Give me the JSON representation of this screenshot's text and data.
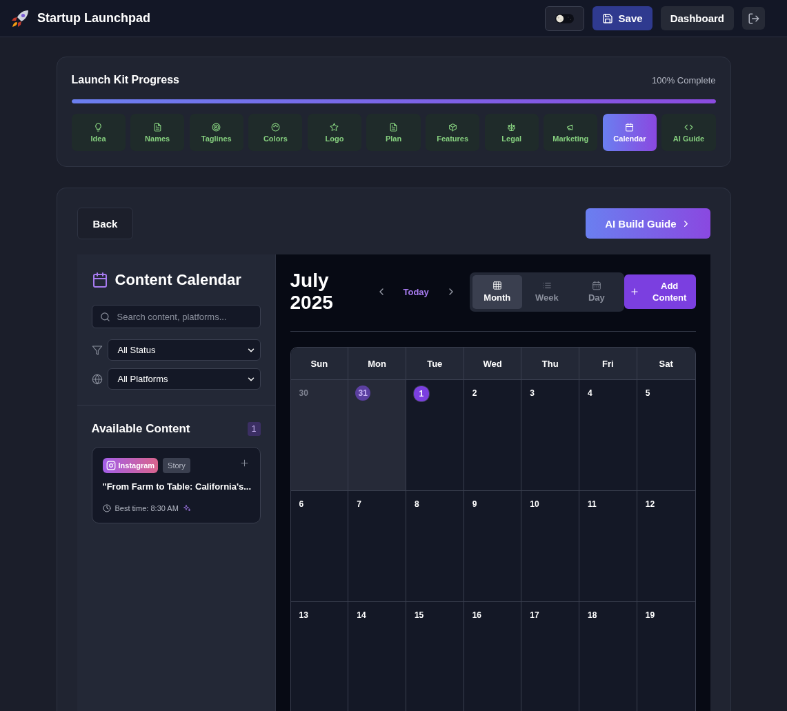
{
  "header": {
    "title": "Startup Launchpad",
    "theme_toggle": {
      "on": false
    },
    "save": "Save",
    "dashboard": "Dashboard"
  },
  "progress": {
    "title": "Launch Kit Progress",
    "status": "100% Complete",
    "level": 1,
    "steps": [
      {
        "label": "Idea",
        "selected": false
      },
      {
        "label": "Names",
        "selected": false
      },
      {
        "label": "Taglines",
        "selected": false
      },
      {
        "label": "Colors",
        "selected": false
      },
      {
        "label": "Logo",
        "selected": false
      },
      {
        "label": "Plan",
        "selected": false
      },
      {
        "label": "Features",
        "selected": false
      },
      {
        "label": "Legal",
        "selected": false
      },
      {
        "label": "Marketing",
        "selected": false
      },
      {
        "label": "Calendar",
        "selected": true
      },
      {
        "label": "AI Guide",
        "selected": false
      }
    ]
  },
  "nav": {
    "back": "Back",
    "guide": "AI Build Guide"
  },
  "sidebar": {
    "title": "Content Calendar",
    "search": {
      "placeholder": "Search content, platforms..."
    },
    "status_filter": "All Status",
    "platform_filter": "All Platforms",
    "available": {
      "title": "Available Content",
      "count": "1",
      "items": [
        {
          "platform": "Instagram",
          "format": "Story",
          "title": "\"From Farm to Table: California's...",
          "best_time": "Best time: 8:30 AM"
        }
      ]
    }
  },
  "calendar": {
    "month": "July 2025",
    "today": "Today",
    "add": "Add Content",
    "views": [
      {
        "label": "Month",
        "selected": true
      },
      {
        "label": "Week",
        "selected": false
      },
      {
        "label": "Day",
        "selected": false
      }
    ],
    "weekdays": [
      "Sun",
      "Mon",
      "Tue",
      "Wed",
      "Thu",
      "Fri",
      "Sat"
    ],
    "weeks": [
      [
        {
          "day": "30",
          "outside": true,
          "today": false,
          "selected": false
        },
        {
          "day": "31",
          "outside": true,
          "today": true,
          "selected": false
        },
        {
          "day": "1",
          "outside": false,
          "today": false,
          "selected": true
        },
        {
          "day": "2",
          "outside": false,
          "today": false,
          "selected": false
        },
        {
          "day": "3",
          "outside": false,
          "today": false,
          "selected": false
        },
        {
          "day": "4",
          "outside": false,
          "today": false,
          "selected": false
        },
        {
          "day": "5",
          "outside": false,
          "today": false,
          "selected": false
        }
      ],
      [
        {
          "day": "6",
          "outside": false,
          "today": false,
          "selected": false
        },
        {
          "day": "7",
          "outside": false,
          "today": false,
          "selected": false
        },
        {
          "day": "8",
          "outside": false,
          "today": false,
          "selected": false
        },
        {
          "day": "9",
          "outside": false,
          "today": false,
          "selected": false
        },
        {
          "day": "10",
          "outside": false,
          "today": false,
          "selected": false
        },
        {
          "day": "11",
          "outside": false,
          "today": false,
          "selected": false
        },
        {
          "day": "12",
          "outside": false,
          "today": false,
          "selected": false
        }
      ],
      [
        {
          "day": "13",
          "outside": false,
          "today": false,
          "selected": false
        },
        {
          "day": "14",
          "outside": false,
          "today": false,
          "selected": false
        },
        {
          "day": "15",
          "outside": false,
          "today": false,
          "selected": false
        },
        {
          "day": "16",
          "outside": false,
          "today": false,
          "selected": false
        },
        {
          "day": "17",
          "outside": false,
          "today": false,
          "selected": false
        },
        {
          "day": "18",
          "outside": false,
          "today": false,
          "selected": false
        },
        {
          "day": "19",
          "outside": false,
          "today": false,
          "selected": false
        }
      ]
    ]
  }
}
